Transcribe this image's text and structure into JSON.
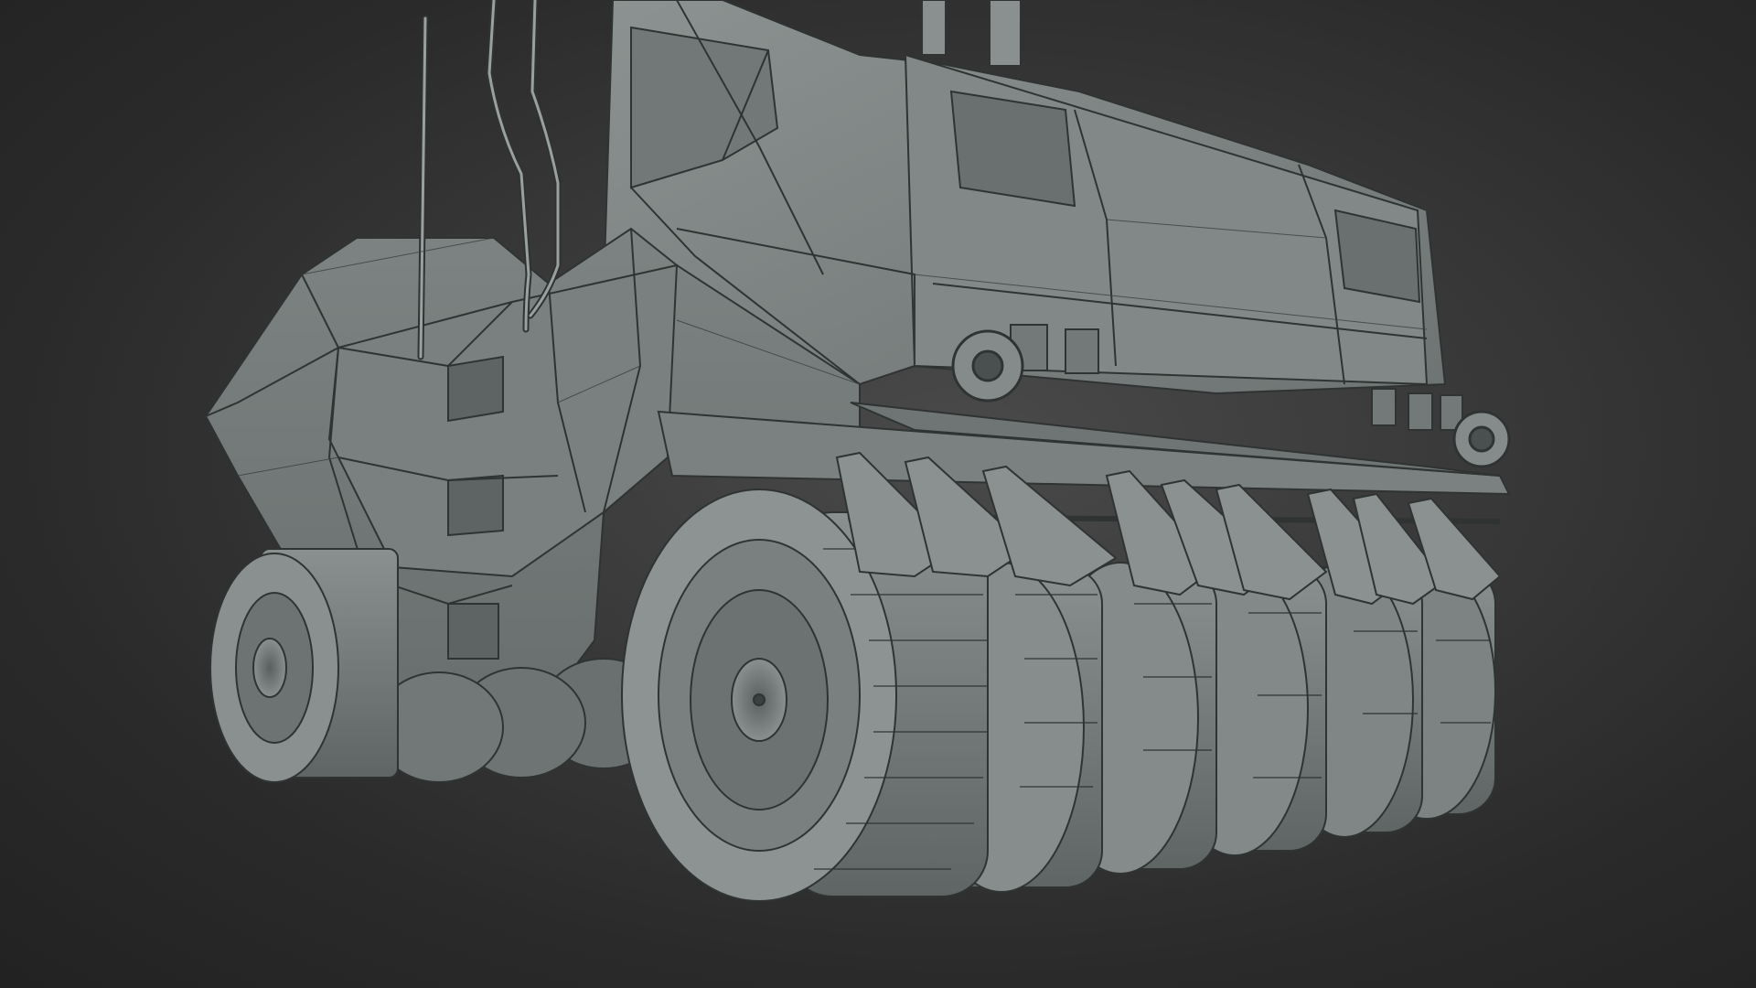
{
  "scene": {
    "subject": "roller-vehicle-wireframe-model",
    "background_color": "#2e2e2e",
    "model_color": "#7f8584",
    "wire_color": "#2f3433"
  }
}
